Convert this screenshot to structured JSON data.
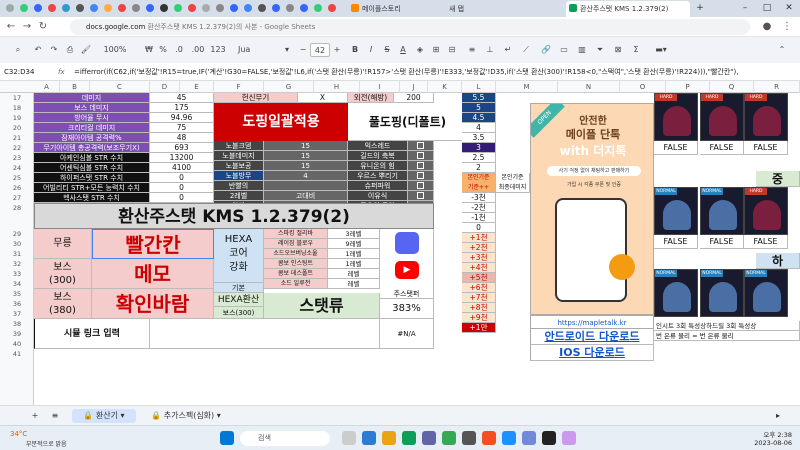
{
  "browser": {
    "tabs": [
      {
        "label": "메이플스토리"
      },
      {
        "label": "새 탭"
      },
      {
        "label": "환산주스탯 KMS 1.2.379(2)"
      }
    ],
    "url_host": "docs.google.com",
    "url_rest": " 환산주스탯 KMS 1.2.379(2)의 사본 - Google Sheets"
  },
  "toolbar": {
    "zoom": "100%",
    "currency": "₩",
    "percent": "%",
    "dec_less": ".0",
    "dec_more": ".00",
    "num_format": "123",
    "font": "Jua",
    "font_size": "42",
    "bold": "B",
    "italic": "I",
    "strike": "S",
    "text_color": "A"
  },
  "formula_bar": {
    "cell_ref": "C32:D34",
    "fx": "fx",
    "formula": "=ifferror(if(C62,if('보정값'!R15=true,IF('계산'!G30=FALSE,'보정값'!L6,if('스탯 환산(무릉)'!R157>'스탯 환산(무릉)'!E333,'보정값'!D35,if('스탯 환산(300)'!R158<0,\"스택여\",'스탯 환산(무릉)'!R224))),\"빨간칸\"),"
  },
  "columns": [
    "A",
    "B",
    "C",
    "D",
    "E",
    "F",
    "G",
    "H",
    "I",
    "J",
    "K",
    "L",
    "M",
    "N",
    "O",
    "P",
    "Q",
    "R"
  ],
  "rows": [
    "17",
    "18",
    "19",
    "20",
    "21",
    "22",
    "23",
    "24",
    "25",
    "26",
    "27",
    "28",
    "29",
    "30",
    "31",
    "32",
    "33",
    "34",
    "35",
    "36",
    "37",
    "38",
    "39",
    "40",
    "41"
  ],
  "stats_table": [
    {
      "label": "데미지",
      "value": "45"
    },
    {
      "label": "보스 데미지",
      "value": "175"
    },
    {
      "label": "방어율 무시",
      "value": "94.96"
    },
    {
      "label": "크리티컬 데미지",
      "value": "75"
    },
    {
      "label": "잠재아이템 공격력%",
      "value": "48"
    },
    {
      "label": "무기아이템 총공격력(보조무기X)",
      "value": "693"
    },
    {
      "label": "아케인심볼 STR 수치",
      "value": "13200"
    },
    {
      "label": "어센틱심볼 STR 수치",
      "value": "4100"
    },
    {
      "label": "하이퍼스탯 STR 수치",
      "value": "0"
    },
    {
      "label": "어빌리티 STR+모든 능력치 수치",
      "value": "0"
    },
    {
      "label": "헥사스탯 STR 수치",
      "value": "0"
    },
    {
      "label": "유니온 공격대원 STR(제논한정)",
      "value": "420"
    }
  ],
  "mid_table_top": {
    "label": "헌신무기",
    "value": "X"
  },
  "buff_table": [
    {
      "label": "노블크뎀",
      "value": "15"
    },
    {
      "label": "노블데미지",
      "value": "15"
    },
    {
      "label": "노블보공",
      "value": "15"
    },
    {
      "label": "노블방무",
      "value": "4"
    },
    {
      "label": "반빨의",
      "value": ""
    },
    {
      "label": "2레벨",
      "value": "고대비"
    },
    {
      "label": "알빠",
      "value": ""
    }
  ],
  "right_top": {
    "label": "외전(해방)",
    "value": "200"
  },
  "doping_all": "도핑일괄적용",
  "full_doping": "풀도핑(디폴트)",
  "doping_list": [
    "익스레드",
    "길드의 축복",
    "유니온의 힘",
    "우르스 뿌리기",
    "슈퍼파워",
    "이유식",
    "풍요의 물약"
  ],
  "doping_last_value": "30",
  "j_column_values": [
    "5.5",
    "5",
    "4.5",
    "4",
    "3.5",
    "3",
    "2.5",
    "2"
  ],
  "j_header": {
    "left": "본인기준\n기준++",
    "right": "본인기준\n최종데미지"
  },
  "j_lower": [
    "-3천",
    "-2천",
    "-1천",
    "0",
    "+1천",
    "+2천",
    "+3천",
    "+4천",
    "+5천",
    "+6천",
    "+7천",
    "+8천",
    "+9천",
    "+1만"
  ],
  "title": "환산주스탯 KMS 1.2.379(2)",
  "labels": {
    "mureung": "무릉",
    "boss300": "보스\n(300)",
    "boss380": "보스\n(380)",
    "link_input": "시뮬 링크 입력"
  },
  "red_cell": "빨간칸",
  "memo": "메모",
  "confirm": "확인바람",
  "hexa": {
    "title": "HEXA\n코어\n강화",
    "base": "기본",
    "convert": "HEXA환산",
    "boss": "보스(300)",
    "stat_u": "스탯류"
  },
  "hexa_skills": [
    {
      "name": "스파킹 절리바",
      "lv": "3레벨"
    },
    {
      "name": "레이징 블로우",
      "lv": "9레벨"
    },
    {
      "name": "소드오브버닝소울",
      "lv": "1레벨"
    },
    {
      "name": "콤보 인스팅트",
      "lv": "1레벨"
    },
    {
      "name": "콤보 데스폴트",
      "lv": "레벨"
    },
    {
      "name": "소드 일루전",
      "lv": "레벨"
    }
  ],
  "streamer": {
    "label": "주스탯퍼",
    "value": "383%"
  },
  "na_value": "#N/A",
  "ad": {
    "badge": "OPEN",
    "line1": "안전한",
    "line2": "메이플 단톡",
    "line3": "with 더지톡",
    "bullet1": "사기 걱정 없이 채팅하고 판매하기",
    "bullet2": "가입 시 각종 쿠폰 및 인증",
    "site": "https://mapletalk.kr"
  },
  "downloads": {
    "android": "안드로이드 다운로드",
    "ios": "IOS 다운로드"
  },
  "far_right_text": {
    "row1": "인시트 3회 특성상하드릴 3회 특성상",
    "row2": "번 은류 물리 = 번 은류 물리"
  },
  "char_cards": [
    {
      "tag": "HARD",
      "result": "FALSE"
    },
    {
      "tag": "HARD",
      "result": "FALSE"
    },
    {
      "tag": "HARD",
      "result": "FALSE"
    },
    {
      "tag": "NORMAL",
      "result": "FALSE"
    },
    {
      "tag": "NORMAL",
      "result": "FALSE"
    },
    {
      "tag": "HARD",
      "result": "FALSE"
    },
    {
      "tag": "NORMAL",
      "result": ""
    },
    {
      "tag": "NORMAL",
      "result": ""
    },
    {
      "tag": "NORMAL",
      "result": ""
    }
  ],
  "side_markers": [
    "중",
    "하"
  ],
  "sheet_tabs": [
    {
      "label": "환산기"
    },
    {
      "label": "추가스펙(심화)"
    }
  ],
  "taskbar": {
    "weather_temp": "34°C",
    "weather_desc": "부분적으로 맑음",
    "search": "검색",
    "time": "오후 2:38",
    "date": "2023-08-06"
  },
  "colors": {
    "purple": "#7d4fb3",
    "red": "#cc0000",
    "black": "#111111",
    "pink": "#f4cccc",
    "hexa_blue": "#cfe2f3",
    "light_green": "#d9ead3",
    "blue_link": "#1155cc",
    "orange": "#f6b26b"
  }
}
